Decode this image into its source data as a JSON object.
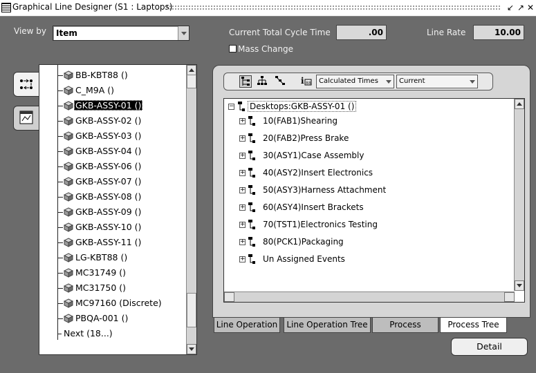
{
  "window": {
    "title": "Graphical Line Designer (S1 : Laptops)",
    "controls": [
      "minimize-restore-icon",
      "maximize-icon",
      "close-icon"
    ]
  },
  "filters": {
    "view_by_label": "View by",
    "view_by_value": "Item",
    "cycle_time_label": "Current Total Cycle Time",
    "cycle_time_value": ".00",
    "line_rate_label": "Line Rate",
    "line_rate_value": "10.00",
    "mass_change_label": "Mass Change",
    "mass_change_checked": false
  },
  "item_list": {
    "selected_index": 2,
    "items": [
      "BB-KBT88 ()",
      "C_M9A ()",
      "GKB-ASSY-01 ()",
      "GKB-ASSY-02 ()",
      "GKB-ASSY-03 ()",
      "GKB-ASSY-04 ()",
      "GKB-ASSY-06 ()",
      "GKB-ASSY-07 ()",
      "GKB-ASSY-08 ()",
      "GKB-ASSY-09 ()",
      "GKB-ASSY-10 ()",
      "GKB-ASSY-11 ()",
      "LG-KBT88 ()",
      "MC31749 ()",
      "MC31750 ()",
      "MC97160 (Discrete)",
      "PBQA-001 ()"
    ],
    "next_label": "Next (18...)"
  },
  "toolbar": {
    "times_dropdown": "Calculated Times",
    "version_dropdown": "Current"
  },
  "tree": {
    "root": "Desktops:GKB-ASSY-01 ()",
    "children": [
      "10(FAB1)Shearing",
      "20(FAB2)Press Brake",
      "30(ASY1)Case Assembly",
      "40(ASY2)Insert Electronics",
      "50(ASY3)Harness Attachment",
      "60(ASY4)Insert Brackets",
      "70(TST1)Electronics Testing",
      "80(PCK1)Packaging",
      "Un Assigned Events"
    ]
  },
  "tabs": [
    "Line Operation",
    "Line Operation Tree",
    "Process",
    "Process Tree"
  ],
  "active_tab": "Process Tree",
  "detail_button": "Detail"
}
